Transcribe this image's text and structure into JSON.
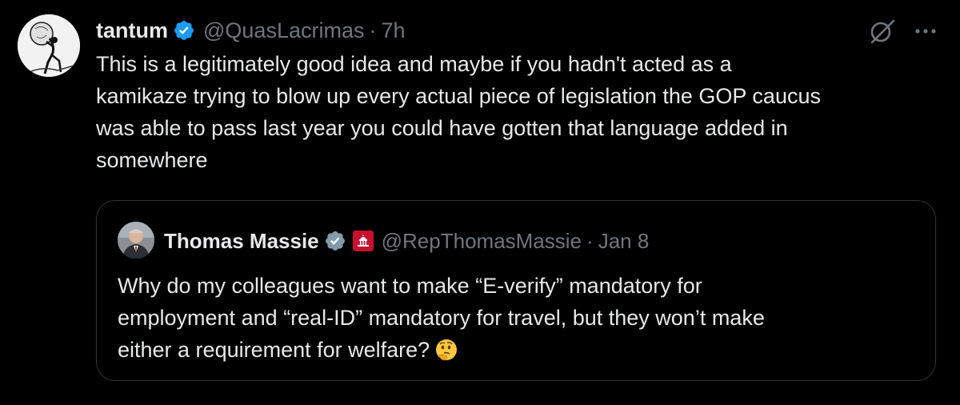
{
  "tweet": {
    "author": {
      "display_name": "tantum",
      "handle": "@QuasLacrimas",
      "separator": "·",
      "time": "7h",
      "avatar_icon": "sisyphus-boulder-avatar",
      "verified_icon": "verified-badge-icon",
      "verified_color": "#1d9bf0"
    },
    "actions": {
      "grok_icon": "grok-icon",
      "more_icon": "more-dots-icon"
    },
    "text_lines": [
      "This is a legitimately good idea and maybe if you hadn't acted as a",
      "kamikaze trying to blow up every actual piece of legislation the GOP caucus",
      "was able to pass last year you could have gotten that language added in",
      "somewhere"
    ]
  },
  "quoted_tweet": {
    "author": {
      "display_name": "Thomas Massie",
      "handle": "@RepThomasMassie",
      "separator": "·",
      "time": "Jan 8",
      "verified_icon": "government-verified-badge-icon",
      "verified_color": "#829aab",
      "affiliation_icon": "us-capitol-badge-icon",
      "affiliation_color": "#c8102e"
    },
    "text_lines": [
      "Why do my colleagues want to make “E-verify” mandatory for",
      "employment and “real-ID” mandatory for travel, but they won’t make",
      "either a requirement for welfare?"
    ],
    "emoji": "thinking-face-emoji"
  },
  "colors": {
    "background": "#000000",
    "text_primary": "#e7e9ea",
    "text_secondary": "#71767b",
    "border": "#2f3336"
  }
}
